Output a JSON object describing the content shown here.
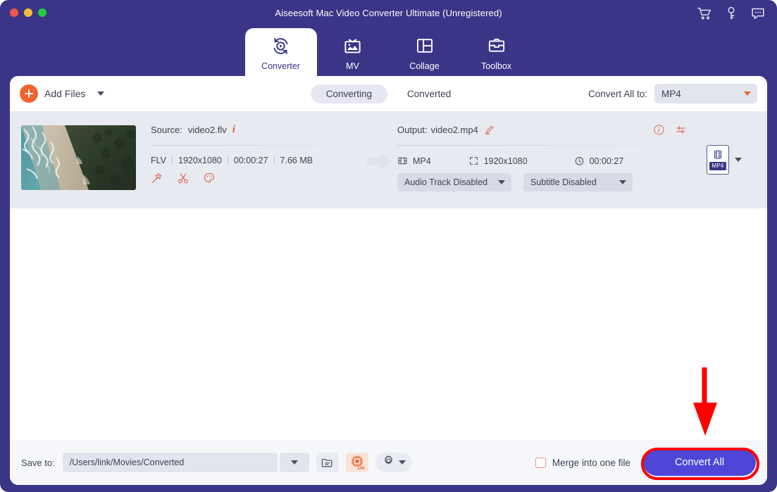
{
  "window": {
    "title": "Aiseesoft Mac Video Converter Ultimate (Unregistered)",
    "traffic_lights": [
      "close",
      "minimize",
      "maximize"
    ],
    "accent_purple": "#3a3587",
    "accent_orange": "#f2622e",
    "convert_button_blue": "#4f46d8",
    "annotation_red": "#ff0000"
  },
  "top_icons": [
    {
      "name": "cart-icon",
      "label": "Buy"
    },
    {
      "name": "key-icon",
      "label": "Register"
    },
    {
      "name": "chat-icon",
      "label": "Feedback"
    }
  ],
  "nav": {
    "tabs": [
      {
        "label": "Converter",
        "icon": "converter-icon",
        "active": true
      },
      {
        "label": "MV",
        "icon": "mv-icon",
        "active": false
      },
      {
        "label": "Collage",
        "icon": "collage-icon",
        "active": false
      },
      {
        "label": "Toolbox",
        "icon": "toolbox-icon",
        "active": false
      }
    ]
  },
  "toolbar": {
    "add_files_label": "Add Files",
    "segments": [
      {
        "label": "Converting",
        "active": true
      },
      {
        "label": "Converted",
        "active": false
      }
    ],
    "convert_all_to_label": "Convert All to:",
    "convert_all_to_value": "MP4"
  },
  "file_item": {
    "thumbnail_alt": "Aerial view of ocean waves, sandy beach and forest",
    "source": {
      "prefix": "Source:",
      "filename": "video2.flv",
      "info_icon": "info-italic-icon",
      "format": "FLV",
      "resolution": "1920x1080",
      "duration": "00:00:27",
      "filesize": "7.66 MB",
      "tools": [
        {
          "name": "magic-wand-icon",
          "label": "Enhance"
        },
        {
          "name": "scissors-icon",
          "label": "Trim"
        },
        {
          "name": "palette-icon",
          "label": "Edit"
        }
      ]
    },
    "output": {
      "prefix": "Output:",
      "filename": "video2.mp4",
      "edit_icon": "pencil-icon",
      "actions": [
        {
          "name": "info-circle-icon",
          "label": "Info"
        },
        {
          "name": "settings-sliders-icon",
          "label": "Settings"
        }
      ],
      "format": "MP4",
      "resolution": "1920x1080",
      "duration": "00:00:27",
      "audio_track": "Audio Track Disabled",
      "subtitle": "Subtitle Disabled",
      "preset_badge": "MP4"
    }
  },
  "bottom_bar": {
    "save_to_label": "Save to:",
    "save_to_path": "/Users/link/Movies/Converted",
    "icons": [
      {
        "name": "open-folder-icon",
        "label": "Open folder"
      },
      {
        "name": "hardware-acceleration-icon",
        "label": "ON"
      },
      {
        "name": "gear-icon",
        "label": "Preferences"
      }
    ],
    "acceleration_state": "ON",
    "merge_label": "Merge into one file",
    "merge_checked": false,
    "convert_all_button": "Convert All"
  }
}
